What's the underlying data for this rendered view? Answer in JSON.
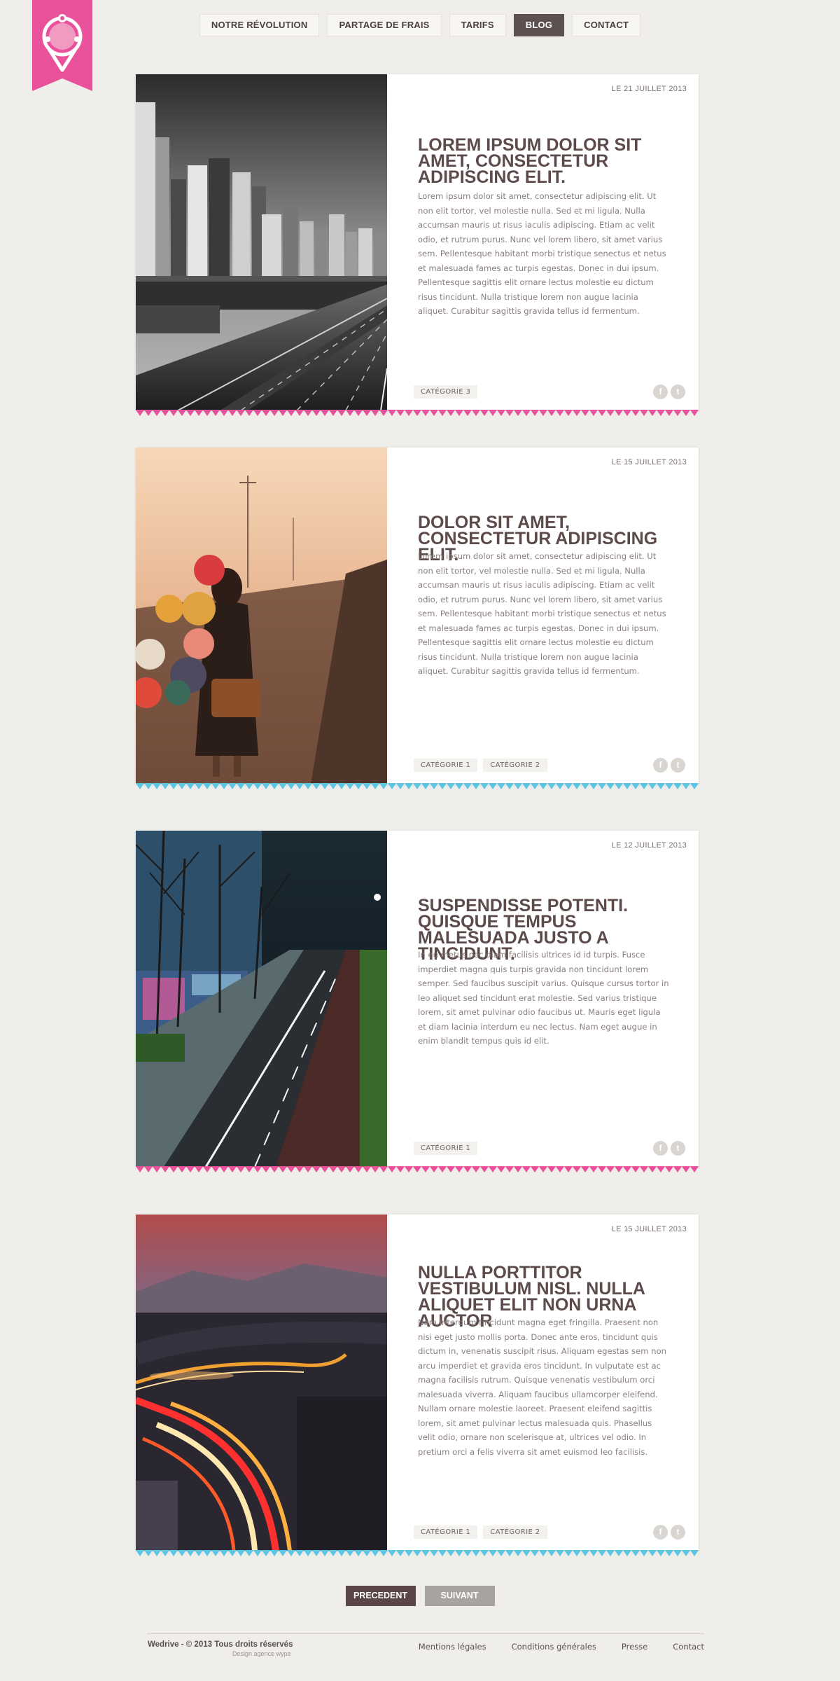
{
  "nav": {
    "items": [
      {
        "label": "NOTRE RÉVOLUTION",
        "active": false
      },
      {
        "label": "PARTAGE DE FRAIS",
        "active": false
      },
      {
        "label": "TARIFS",
        "active": false
      },
      {
        "label": "BLOG",
        "active": true
      },
      {
        "label": "CONTACT",
        "active": false
      }
    ]
  },
  "logo": {
    "icon": "map-pin-icon",
    "color": "#e9529a"
  },
  "posts": [
    {
      "date": "LE 21 JUILLET 2013",
      "title": "LOREM IPSUM DOLOR SIT AMET, CONSECTETUR ADIPISCING ELIT.",
      "body": "Lorem ipsum dolor sit amet, consectetur adipiscing elit. Ut non elit tortor, vel molestie nulla. Sed et mi ligula. Nulla accumsan mauris ut risus iaculis adipiscing. Etiam ac velit odio, et rutrum purus. Nunc vel lorem libero, sit amet varius sem. Pellentesque habitant morbi tristique senectus et netus et malesuada fames ac turpis egestas. Donec in dui ipsum. Pellentesque sagittis elit ornare lectus molestie eu dictum risus tincidunt. Nulla tristique lorem non augue lacinia aliquet. Curabitur sagittis gravida tellus id fermentum.",
      "categories": [
        "CATÉGORIE 3"
      ],
      "image": "city-highway-photo",
      "accent": "#e9529a"
    },
    {
      "date": "LE 15 JUILLET 2013",
      "title": "DOLOR SIT AMET, CONSECTETUR ADIPISCING ELIT.",
      "body": "Lorem ipsum dolor sit amet, consectetur adipiscing elit. Ut non elit tortor, vel molestie nulla. Sed et mi ligula. Nulla accumsan mauris ut risus iaculis adipiscing. Etiam ac velit odio, et rutrum purus. Nunc vel lorem libero, sit amet varius sem. Pellentesque habitant morbi tristique senectus et netus et malesuada fames ac turpis egestas. Donec in dui ipsum. Pellentesque sagittis elit ornare lectus molestie eu dictum risus tincidunt. Nulla tristique lorem non augue lacinia aliquet. Curabitur sagittis gravida tellus id fermentum.",
      "categories": [
        "CATÉGORIE 1",
        "CATÉGORIE 2"
      ],
      "image": "girl-balloons-photo",
      "accent": "#5cc6e6"
    },
    {
      "date": "LE 12 JUILLET 2013",
      "title": "SUSPENDISSE POTENTI. QUISQUE TEMPUS MALESUADA JUSTO A TINCIDUNT.",
      "body": "In eu metus nec diam facilisis ultrices id id turpis. Fusce imperdiet magna quis turpis gravida non tincidunt lorem semper. Sed faucibus suscipit varius. Quisque cursus tortor in leo aliquet sed tincidunt erat molestie. Sed varius tristique lorem, sit amet pulvinar odio faucibus ut. Mauris eget ligula et diam lacinia interdum eu nec lectus. Nam eget augue in enim blandit tempus quis id elit.",
      "categories": [
        "CATÉGORIE 1"
      ],
      "image": "night-street-photo",
      "accent": "#e9529a"
    },
    {
      "date": "LE 15 JUILLET 2013",
      "title": "NULLA PORTTITOR VESTIBULUM NISL. NULLA ALIQUET ELIT NON URNA AUCTOR",
      "body": "Nam interdum tincidunt magna eget fringilla. Praesent non nisi eget justo mollis porta. Donec ante eros, tincidunt quis dictum in, venenatis suscipit risus. Aliquam egestas sem non arcu imperdiet et gravida eros tincidunt. In vulputate est ac magna facilisis rutrum. Quisque venenatis vestibulum orci malesuada viverra. Aliquam faucibus ullamcorper eleifend. Nullam ornare molestie laoreet. Praesent eleifend sagittis lorem, sit amet pulvinar lectus malesuada quis. Phasellus velit odio, ornare non scelerisque at, ultrices vel odio. In pretium orci a felis viverra sit amet euismod leo facilisis.",
      "categories": [
        "CATÉGORIE 1",
        "CATÉGORIE 2"
      ],
      "image": "light-trails-photo",
      "accent": "#5cc6e6"
    }
  ],
  "social": {
    "facebook": "f",
    "twitter": "t"
  },
  "pager": {
    "prev": "PRECEDENT",
    "next": "SUIVANT"
  },
  "footer": {
    "brand": "Wedrive",
    "copyright": " -  © 2013 Tous droits réservés",
    "credit": "Design agence wype",
    "links": [
      "Mentions légales",
      "Conditions générales",
      "Presse",
      "Contact"
    ]
  }
}
